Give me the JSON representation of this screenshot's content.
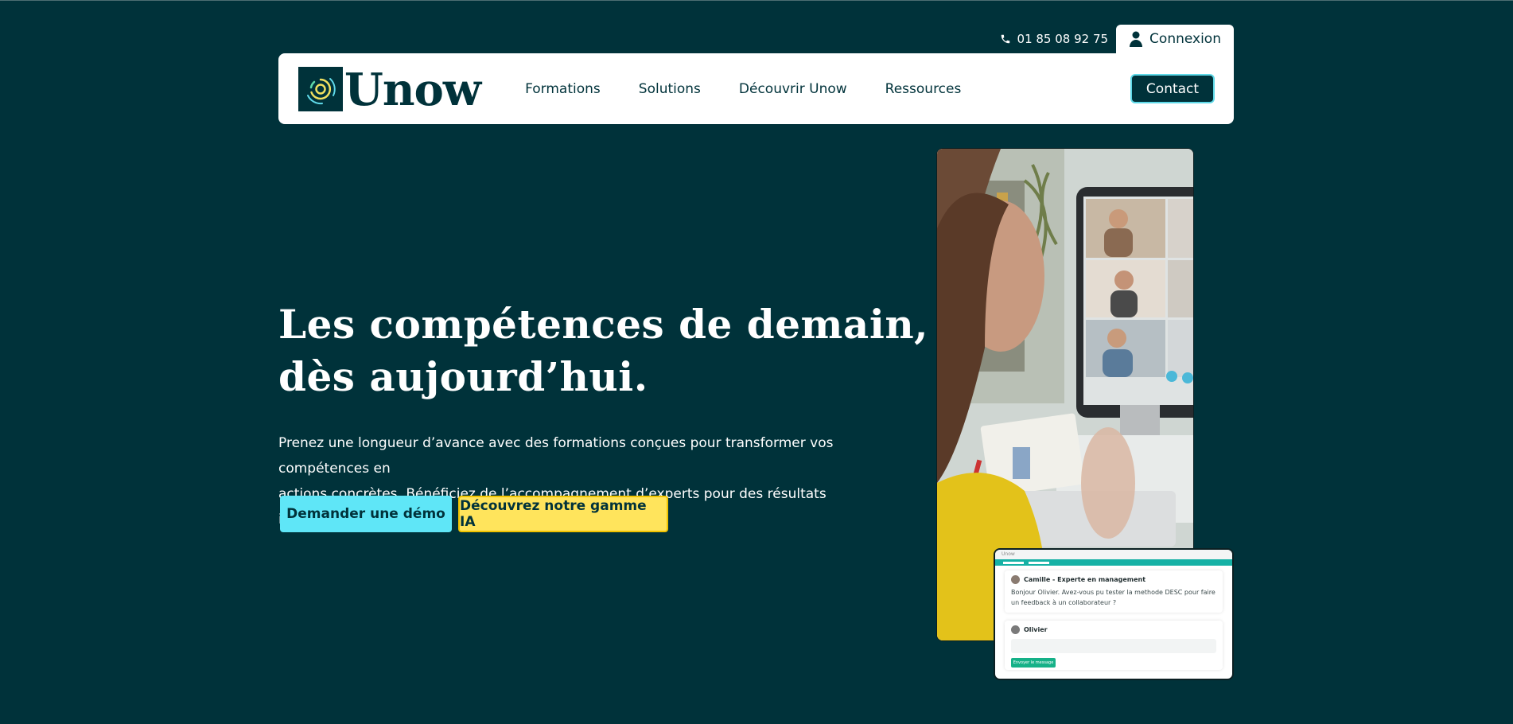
{
  "header": {
    "phone": "01 85 08 92 75",
    "login_label": "Connexion",
    "logo_text": "Unow",
    "nav": [
      {
        "label": "Formations"
      },
      {
        "label": "Solutions"
      },
      {
        "label": "Découvrir Unow"
      },
      {
        "label": "Ressources"
      }
    ],
    "contact_label": "Contact"
  },
  "hero": {
    "title_lines": [
      "Les compétences de demain,",
      "dès aujourd’hui."
    ],
    "description_lines": [
      "Prenez une longueur d’avance avec des formations conçues pour transformer vos compétences en",
      "actions concrètes. Bénéficiez de l’accompagnement d’experts pour des résultats immédiats."
    ],
    "primary_button": "Demander une démo",
    "secondary_button": "Découvrez notre gamme IA"
  },
  "chat_preview": {
    "app_label": "Unow",
    "author": "Camille - Experte en management",
    "message": "Bonjour Olivier. Avez-vous pu tester la methode DESC pour faire un feedback à un collaborateur ?",
    "reply_author": "Olivier",
    "send_label": "Envoyer le message"
  },
  "colors": {
    "background": "#00323a",
    "accent_cyan": "#5fe6f7",
    "accent_yellow": "#ffe45c",
    "chat_teal": "#16b1a5"
  },
  "icons": {
    "phone": "phone-icon",
    "user": "user-icon",
    "logo": "unow-logo-icon"
  }
}
